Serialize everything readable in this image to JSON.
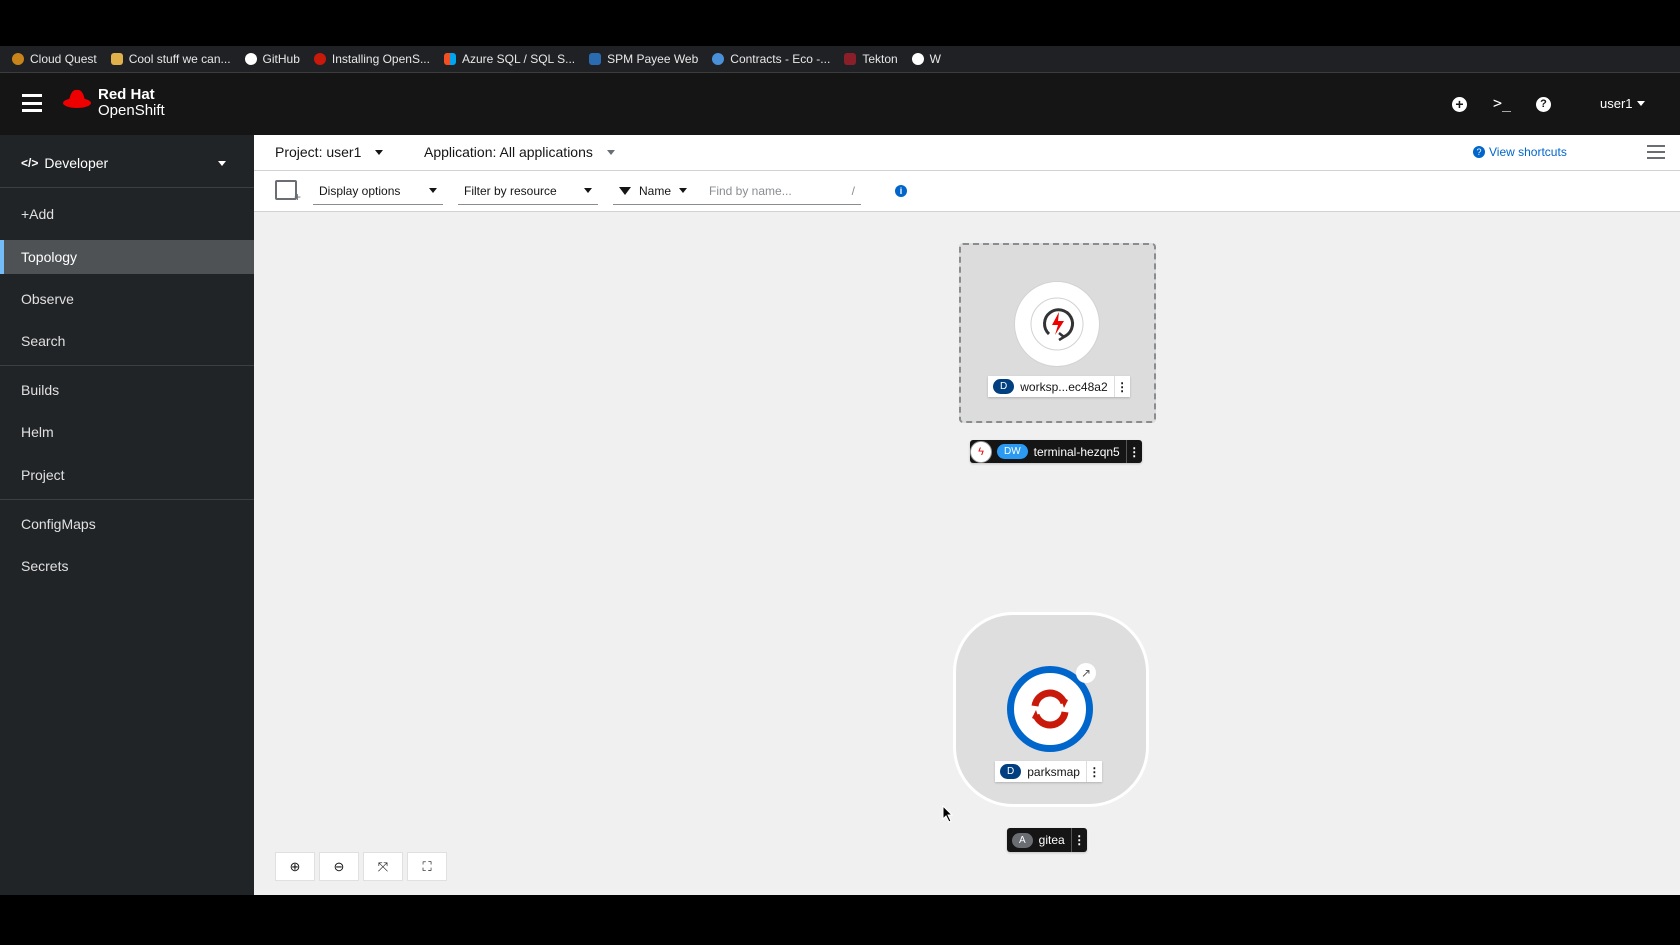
{
  "bookmarks": [
    {
      "label": "Cloud Quest",
      "color": "#c8841a"
    },
    {
      "label": "Cool stuff we can...",
      "color": "#e0b04a"
    },
    {
      "label": "GitHub",
      "color": "#ffffff"
    },
    {
      "label": "Installing OpenS...",
      "color": "#c9190b"
    },
    {
      "label": "Azure SQL / SQL S...",
      "color": "#f25022"
    },
    {
      "label": "SPM Payee Web",
      "color": "#2b6cb0"
    },
    {
      "label": "Contracts - Eco -...",
      "color": "#4a90d9"
    },
    {
      "label": "Tekton",
      "color": "#8a1f2a"
    },
    {
      "label": "W",
      "color": "#ffffff"
    }
  ],
  "header": {
    "brand_line1": "Red Hat",
    "brand_line2": "OpenShift",
    "user": "user1"
  },
  "sidebar": {
    "perspective": "Developer",
    "items": [
      {
        "label": "+Add"
      },
      {
        "label": "Topology",
        "active": true
      },
      {
        "label": "Observe"
      },
      {
        "label": "Search"
      },
      {
        "label": "Builds"
      },
      {
        "label": "Helm"
      },
      {
        "label": "Project"
      },
      {
        "label": "ConfigMaps"
      },
      {
        "label": "Secrets"
      }
    ]
  },
  "toolbar": {
    "project": "Project: user1",
    "application": "Application: All applications",
    "view_shortcuts": "View shortcuts",
    "display_options": "Display options",
    "filter_by_resource": "Filter by resource",
    "filter_type": "Name",
    "find_placeholder": "Find by name...",
    "find_shortcut": "/"
  },
  "topology": {
    "workspace": {
      "badge": "D",
      "name": "worksp...ec48a2",
      "group_badge": "DW",
      "group_name": "terminal-hezqn5"
    },
    "parksmap": {
      "badge": "D",
      "name": "parksmap",
      "group_badge": "A",
      "group_name": "gitea"
    }
  },
  "colors": {
    "accent": "#73bcf7",
    "deployment_badge": "#004080",
    "devworkspace_badge": "#2b9af3",
    "app_badge": "#6a6e73"
  }
}
